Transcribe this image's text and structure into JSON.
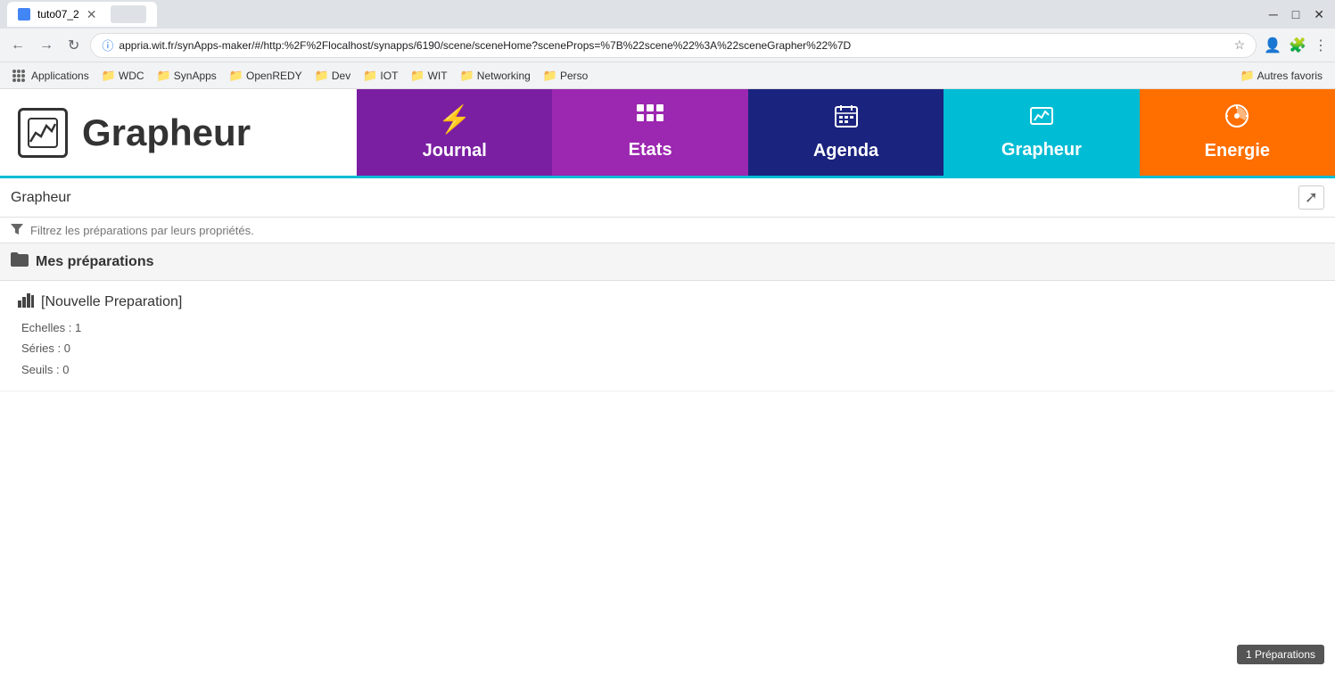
{
  "browser": {
    "tab_title": "tuto07_2",
    "url": "appria.wit.fr/synApps-maker/#/http:%2F%2Flocalhost/synapps/6190/scene/sceneHome?sceneProps=%7B%22scene%22%3A%22sceneGrapher%22%7D",
    "nav": {
      "back_disabled": false,
      "forward_disabled": false
    },
    "bookmarks": [
      {
        "label": "Applications",
        "type": "apps"
      },
      {
        "label": "WDC",
        "type": "folder"
      },
      {
        "label": "SynApps",
        "type": "folder"
      },
      {
        "label": "OpenREDY",
        "type": "folder"
      },
      {
        "label": "Dev",
        "type": "folder"
      },
      {
        "label": "IOT",
        "type": "folder"
      },
      {
        "label": "WIT",
        "type": "folder"
      },
      {
        "label": "Networking",
        "type": "folder"
      },
      {
        "label": "Perso",
        "type": "folder"
      },
      {
        "label": "Autres favoris",
        "type": "folder"
      }
    ],
    "win_controls": [
      "─",
      "□",
      "✕"
    ]
  },
  "app": {
    "logo_text": "Grapheur",
    "tabs": [
      {
        "id": "journal",
        "label": "Journal",
        "icon": "⚡",
        "class": "tab-journal"
      },
      {
        "id": "etats",
        "label": "Etats",
        "icon": "▦",
        "class": "tab-etats"
      },
      {
        "id": "agenda",
        "label": "Agenda",
        "icon": "📅",
        "class": "tab-agenda"
      },
      {
        "id": "grapheur",
        "label": "Grapheur",
        "icon": "🖼",
        "class": "tab-grapheur",
        "active": true
      },
      {
        "id": "energie",
        "label": "Energie",
        "icon": "⏱",
        "class": "tab-energie"
      }
    ]
  },
  "page": {
    "breadcrumb": "Grapheur",
    "filter_placeholder": "Filtrez les préparations par leurs propriétés.",
    "section_title": "Mes préparations",
    "preparations": [
      {
        "title": "[Nouvelle Preparation]",
        "echelles": "1",
        "series": "0",
        "seuils": "0"
      }
    ],
    "labels": {
      "echelles": "Echelles",
      "series": "Séries",
      "seuils": "Seuils"
    }
  },
  "bottom_badge": "1 Préparations"
}
